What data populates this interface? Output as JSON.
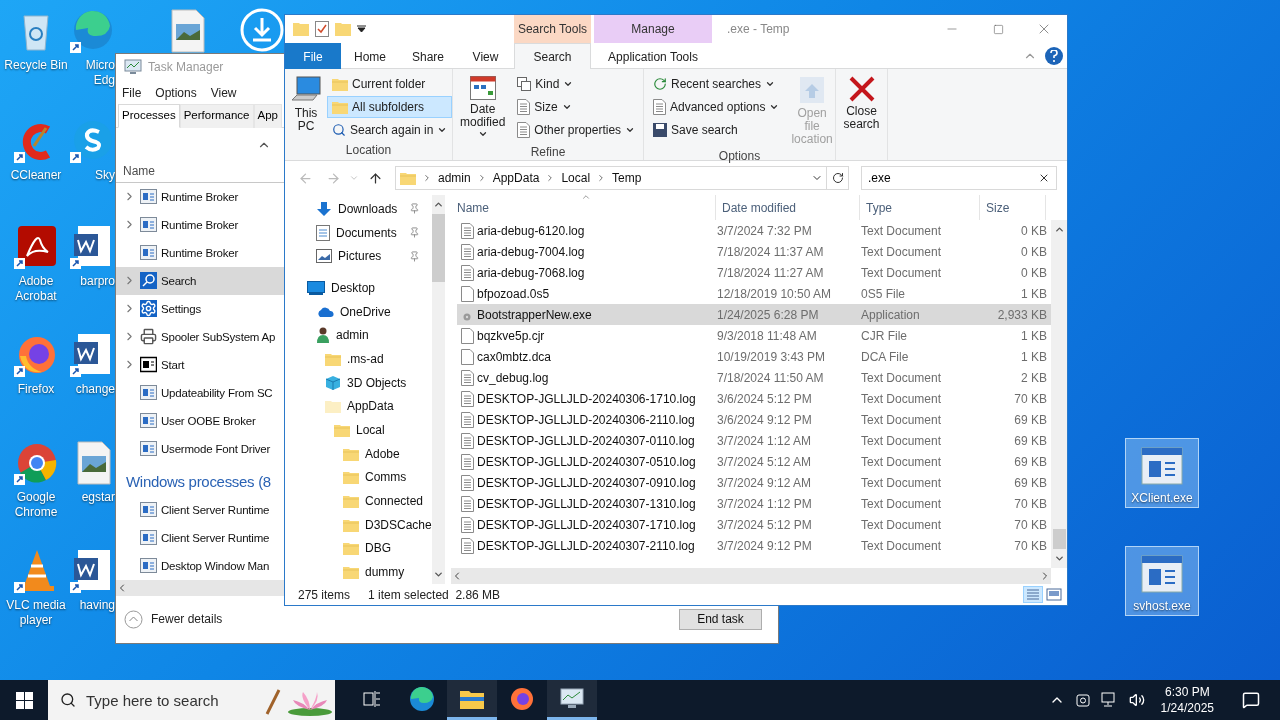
{
  "desktop": {
    "columns": [
      [
        {
          "label": "Recycle Bin",
          "kind": "recycle"
        },
        {
          "label": "CCleaner",
          "kind": "ccleaner"
        },
        {
          "label": "Adobe Acrobat",
          "kind": "acrobat"
        },
        {
          "label": "Firefox",
          "kind": "firefox"
        },
        {
          "label": "Google Chrome",
          "kind": "chrome"
        },
        {
          "label": "VLC media player",
          "kind": "vlc"
        }
      ],
      [
        {
          "label": "Micro\nEdg",
          "kind": "edge"
        },
        {
          "label": "Sky",
          "kind": "skype"
        },
        {
          "label": "barpro",
          "kind": "word"
        },
        {
          "label": "change",
          "kind": "word"
        },
        {
          "label": "egstar",
          "kind": "image"
        },
        {
          "label": "having",
          "kind": "word"
        }
      ],
      [
        {
          "kind": "image"
        }
      ],
      [
        {
          "kind": "download"
        }
      ]
    ],
    "files": [
      {
        "label": "XClient.exe",
        "selected": true
      },
      {
        "label": "svhost.exe",
        "selected": true
      }
    ]
  },
  "task_manager": {
    "title": "Task Manager",
    "menu": [
      "File",
      "Options",
      "View"
    ],
    "tabs": [
      {
        "label": "Processes",
        "selected": true
      },
      {
        "label": "Performance",
        "selected": false
      },
      {
        "label": "App",
        "selected": false
      }
    ],
    "column": "Name",
    "processes": [
      {
        "name": "Runtime Broker",
        "expandable": true,
        "selected": false,
        "kind": "app"
      },
      {
        "name": "Runtime Broker",
        "expandable": true,
        "selected": false,
        "kind": "app"
      },
      {
        "name": "Runtime Broker",
        "expandable": false,
        "selected": false,
        "kind": "app"
      },
      {
        "name": "Search",
        "expandable": true,
        "selected": true,
        "kind": "search"
      },
      {
        "name": "Settings",
        "expandable": true,
        "selected": false,
        "kind": "settings"
      },
      {
        "name": "Spooler SubSystem Ap",
        "expandable": true,
        "selected": false,
        "kind": "printer"
      },
      {
        "name": "Start",
        "expandable": true,
        "selected": false,
        "kind": "start"
      },
      {
        "name": "Updateability From SC",
        "expandable": false,
        "selected": false,
        "kind": "app"
      },
      {
        "name": "User OOBE Broker",
        "expandable": false,
        "selected": false,
        "kind": "app"
      },
      {
        "name": "Usermode Font Driver",
        "expandable": false,
        "selected": false,
        "kind": "app"
      }
    ],
    "group": "Windows processes (8",
    "windows_processes": [
      {
        "name": "Client Server Runtime",
        "expandable": false,
        "selected": false,
        "kind": "app"
      },
      {
        "name": "Client Server Runtime",
        "expandable": false,
        "selected": false,
        "kind": "app"
      },
      {
        "name": "Desktop Window Man",
        "expandable": false,
        "selected": false,
        "kind": "app"
      }
    ],
    "fewer_details": "Fewer details",
    "end_task": "End task"
  },
  "explorer": {
    "title": ".exe - Temp",
    "context_headers": [
      {
        "label": "Search Tools",
        "color": "#fbd8c4"
      },
      {
        "label": "Manage",
        "color": "#e9cdf6"
      }
    ],
    "tabs": [
      {
        "label": "File",
        "kind": "file",
        "selected": false
      },
      {
        "label": "Home",
        "kind": "tab",
        "selected": false
      },
      {
        "label": "Share",
        "kind": "tab",
        "selected": false
      },
      {
        "label": "View",
        "kind": "tab",
        "selected": false
      },
      {
        "label": "Search",
        "kind": "tab",
        "selected": true
      },
      {
        "label": "Application Tools",
        "kind": "tab",
        "selected": false
      }
    ],
    "ribbon": {
      "location": {
        "label": "Location",
        "this_pc": "This PC",
        "current_folder": {
          "label": "Current folder",
          "selected": false
        },
        "all_subfolders": {
          "label": "All subfolders",
          "selected": true
        },
        "search_again": "Search again in"
      },
      "refine": {
        "label": "Refine",
        "date_modified": "Date modified",
        "kind": "Kind",
        "size": "Size",
        "other": "Other properties"
      },
      "options": {
        "label": "Options",
        "recent": "Recent searches",
        "advanced": "Advanced options",
        "save": "Save search",
        "open_location": {
          "label": "Open file location",
          "disabled": true
        }
      },
      "close": "Close search"
    },
    "breadcrumbs": [
      "admin",
      "AppData",
      "Local",
      "Temp"
    ],
    "search": {
      "value": ".exe"
    },
    "navigation": {
      "quick_access": [
        {
          "label": "Downloads",
          "kind": "download",
          "pinned": true
        },
        {
          "label": "Documents",
          "kind": "documents",
          "pinned": true
        },
        {
          "label": "Pictures",
          "kind": "pictures",
          "pinned": true
        }
      ],
      "tree": [
        {
          "label": "Desktop",
          "kind": "desktop",
          "children": [
            {
              "label": "OneDrive",
              "kind": "onedrive"
            },
            {
              "label": "admin",
              "kind": "user",
              "children": [
                {
                  "label": ".ms-ad",
                  "kind": "folder"
                },
                {
                  "label": "3D Objects",
                  "kind": "objects"
                },
                {
                  "label": "AppData",
                  "kind": "hidden",
                  "children": [
                    {
                      "label": "Local",
                      "kind": "folder",
                      "children": [
                        {
                          "label": "Adobe",
                          "kind": "folder"
                        },
                        {
                          "label": "Comms",
                          "kind": "folder"
                        },
                        {
                          "label": "Connected",
                          "kind": "folder"
                        },
                        {
                          "label": "D3DSCache",
                          "kind": "folder"
                        },
                        {
                          "label": "DBG",
                          "kind": "folder"
                        },
                        {
                          "label": "dummy",
                          "kind": "folder"
                        }
                      ]
                    }
                  ]
                }
              ]
            }
          ]
        }
      ]
    },
    "columns": [
      "Name",
      "Date modified",
      "Type",
      "Size"
    ],
    "rows": [
      {
        "name": "aria-debug-6120.log",
        "date": "3/7/2024 7:32 PM",
        "type": "Text Document",
        "size": "0 KB",
        "kind": "text",
        "selected": false
      },
      {
        "name": "aria-debug-7004.log",
        "date": "7/18/2024 11:37 AM",
        "type": "Text Document",
        "size": "0 KB",
        "kind": "text",
        "selected": false
      },
      {
        "name": "aria-debug-7068.log",
        "date": "7/18/2024 11:27 AM",
        "type": "Text Document",
        "size": "0 KB",
        "kind": "text",
        "selected": false
      },
      {
        "name": "bfpozoad.0s5",
        "date": "12/18/2019 10:50 AM",
        "type": "0S5 File",
        "size": "1 KB",
        "kind": "blank",
        "selected": false
      },
      {
        "name": "BootstrapperNew.exe",
        "date": "1/24/2025 6:28 PM",
        "type": "Application",
        "size": "2,933 KB",
        "kind": "app",
        "selected": true
      },
      {
        "name": "bqzkve5p.cjr",
        "date": "9/3/2018 11:48 AM",
        "type": "CJR File",
        "size": "1 KB",
        "kind": "blank",
        "selected": false
      },
      {
        "name": "cax0mbtz.dca",
        "date": "10/19/2019 3:43 PM",
        "type": "DCA File",
        "size": "1 KB",
        "kind": "blank",
        "selected": false
      },
      {
        "name": "cv_debug.log",
        "date": "7/18/2024 11:50 AM",
        "type": "Text Document",
        "size": "2 KB",
        "kind": "text",
        "selected": false
      },
      {
        "name": "DESKTOP-JGLLJLD-20240306-1710.log",
        "date": "3/6/2024 5:12 PM",
        "type": "Text Document",
        "size": "70 KB",
        "kind": "text",
        "selected": false
      },
      {
        "name": "DESKTOP-JGLLJLD-20240306-2110.log",
        "date": "3/6/2024 9:12 PM",
        "type": "Text Document",
        "size": "69 KB",
        "kind": "text",
        "selected": false
      },
      {
        "name": "DESKTOP-JGLLJLD-20240307-0110.log",
        "date": "3/7/2024 1:12 AM",
        "type": "Text Document",
        "size": "69 KB",
        "kind": "text",
        "selected": false
      },
      {
        "name": "DESKTOP-JGLLJLD-20240307-0510.log",
        "date": "3/7/2024 5:12 AM",
        "type": "Text Document",
        "size": "69 KB",
        "kind": "text",
        "selected": false
      },
      {
        "name": "DESKTOP-JGLLJLD-20240307-0910.log",
        "date": "3/7/2024 9:12 AM",
        "type": "Text Document",
        "size": "69 KB",
        "kind": "text",
        "selected": false
      },
      {
        "name": "DESKTOP-JGLLJLD-20240307-1310.log",
        "date": "3/7/2024 1:12 PM",
        "type": "Text Document",
        "size": "70 KB",
        "kind": "text",
        "selected": false
      },
      {
        "name": "DESKTOP-JGLLJLD-20240307-1710.log",
        "date": "3/7/2024 5:12 PM",
        "type": "Text Document",
        "size": "70 KB",
        "kind": "text",
        "selected": false
      },
      {
        "name": "DESKTOP-JGLLJLD-20240307-2110.log",
        "date": "3/7/2024 9:12 PM",
        "type": "Text Document",
        "size": "70 KB",
        "kind": "text",
        "selected": false
      }
    ],
    "status": {
      "count": "275 items",
      "selection": "1 item selected  2.86 MB"
    }
  },
  "taskbar": {
    "search": {
      "placeholder": "Type here to search"
    },
    "apps": [
      {
        "kind": "taskview",
        "active": false
      },
      {
        "kind": "edge",
        "active": false
      },
      {
        "kind": "explorer",
        "active": true
      },
      {
        "kind": "firefox",
        "active": false
      },
      {
        "kind": "taskmgr",
        "active": true
      }
    ],
    "time": "6:30 PM",
    "date": "1/24/2025"
  }
}
